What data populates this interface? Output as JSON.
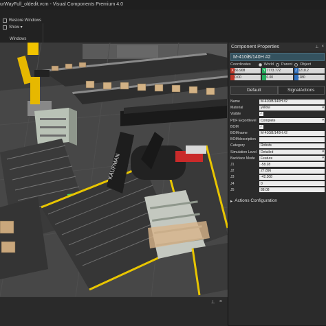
{
  "window": {
    "title": "urWayFull_oldedit.vcm - Visual Components Premium 4.0"
  },
  "ribbon": {
    "restore_windows": "Restore Windows",
    "show": "Show ▾",
    "group_label": "Windows"
  },
  "viewport": {
    "robot_brand": "KAUFMAN"
  },
  "panel": {
    "title": "Component Properties",
    "component_name": "M-410iB/140H #2",
    "coordinates_label": "Coordinates",
    "coord_options": [
      "World",
      "Parent",
      "Object"
    ],
    "coord_selected": "World",
    "xyz": [
      {
        "tag": "X",
        "color": "#c0392b",
        "value": "66.908"
      },
      {
        "tag": "Y",
        "color": "#27ae60",
        "value": "7773.772"
      },
      {
        "tag": "Z",
        "color": "#2e6fbf",
        "value": "1218.2"
      },
      {
        "tag": "Rx",
        "color": "#c0392b",
        "value": "0.00"
      },
      {
        "tag": "Ry",
        "color": "#27ae60",
        "value": "0.00"
      },
      {
        "tag": "Rz",
        "color": "#2e6fbf",
        "value": "-180"
      }
    ],
    "tabs": [
      "Default",
      "SignalActions"
    ],
    "props": [
      {
        "label": "Name",
        "value": "M-410iB/140H #2",
        "kind": "text"
      },
      {
        "label": "Material",
        "value": "yellow",
        "kind": "select"
      },
      {
        "label": "Visible",
        "value": "✓",
        "kind": "check"
      },
      {
        "label": "PDF Exportlevel",
        "value": "Complete",
        "kind": "select"
      },
      {
        "label": "BOM",
        "value": "✓",
        "kind": "check"
      },
      {
        "label": "BOMname",
        "value": "M-410iB/140H #2",
        "kind": "text"
      },
      {
        "label": "BOMdescription",
        "value": "",
        "kind": "text"
      },
      {
        "label": "Category",
        "value": "Robots",
        "kind": "text"
      },
      {
        "label": "Simulation Level",
        "value": "Detailed",
        "kind": "select"
      },
      {
        "label": "Backface Mode",
        "value": "Feature",
        "kind": "select"
      },
      {
        "label": "J1",
        "value": "-58.28",
        "kind": "text"
      },
      {
        "label": "J2",
        "value": "27.896",
        "kind": "text"
      },
      {
        "label": "J3",
        "value": "-42.308",
        "kind": "text"
      },
      {
        "label": "J4",
        "value": "0",
        "kind": "text"
      },
      {
        "label": "J5",
        "value": "88.08",
        "kind": "text"
      }
    ],
    "actions_configuration": "Actions Configuration"
  }
}
